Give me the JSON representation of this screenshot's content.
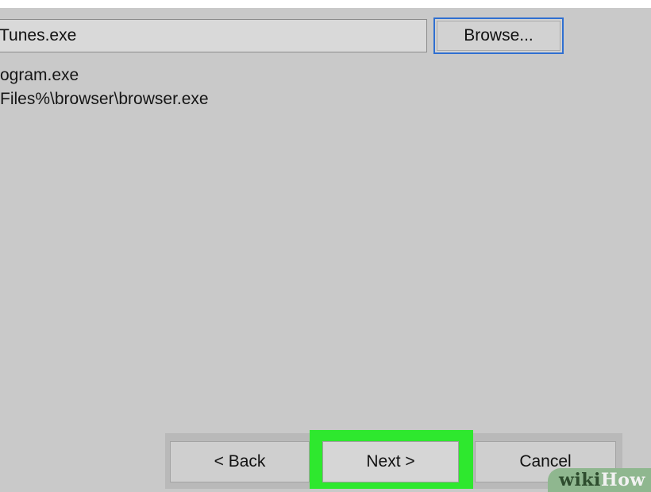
{
  "program": {
    "path_value": "Tunes.exe",
    "browse_label": "Browse..."
  },
  "recent_items": [
    "ogram.exe",
    "Files%\\browser\\browser.exe"
  ],
  "wizard_buttons": {
    "back_label": "< Back",
    "next_label": "Next >",
    "cancel_label": "Cancel"
  },
  "highlight": {
    "color": "#2ee82e",
    "target": "next-button"
  },
  "watermark": {
    "part1": "wiki",
    "part2": "How"
  }
}
